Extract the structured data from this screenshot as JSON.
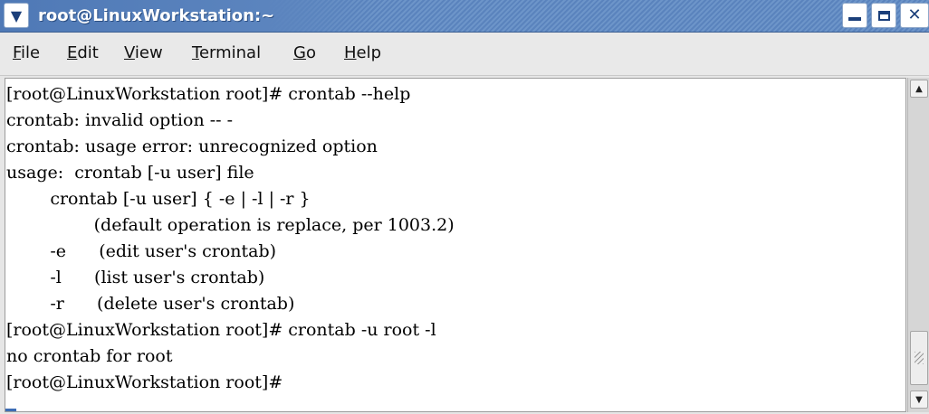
{
  "window": {
    "title": "root@LinuxWorkstation:~",
    "title_menu_icon": "chevron-down-icon",
    "controls": {
      "minimize_icon": "minimize-icon",
      "maximize_icon": "maximize-icon",
      "close_icon": "close-icon"
    }
  },
  "menubar": {
    "items": [
      {
        "label_ul": "F",
        "label_rest": "ile"
      },
      {
        "label_ul": "E",
        "label_rest": "dit"
      },
      {
        "label_ul": "V",
        "label_rest": "iew"
      },
      {
        "label_ul": "T",
        "label_rest": "erminal"
      },
      {
        "label_ul": "G",
        "label_rest": "o"
      },
      {
        "label_ul": "H",
        "label_rest": "elp"
      }
    ]
  },
  "terminal": {
    "lines": [
      "[root@LinuxWorkstation root]# crontab --help",
      "crontab: invalid option -- -",
      "crontab: usage error: unrecognized option",
      "usage:  crontab [-u user] file",
      "        crontab [-u user] { -e | -l | -r }",
      "                (default operation is replace, per 1003.2)",
      "        -e      (edit user's crontab)",
      "        -l      (list user's crontab)",
      "        -r      (delete user's crontab)",
      "[root@LinuxWorkstation root]# crontab -u root -l",
      "no crontab for root",
      "[root@LinuxWorkstation root]#"
    ]
  },
  "scrollbar": {
    "up_icon": "scroll-up-arrow-icon",
    "down_icon": "scroll-down-arrow-icon"
  },
  "colors": {
    "titlebar": "#5a83bd",
    "terminal_bg": "#ffffff",
    "cursor": "#3d6db5"
  }
}
